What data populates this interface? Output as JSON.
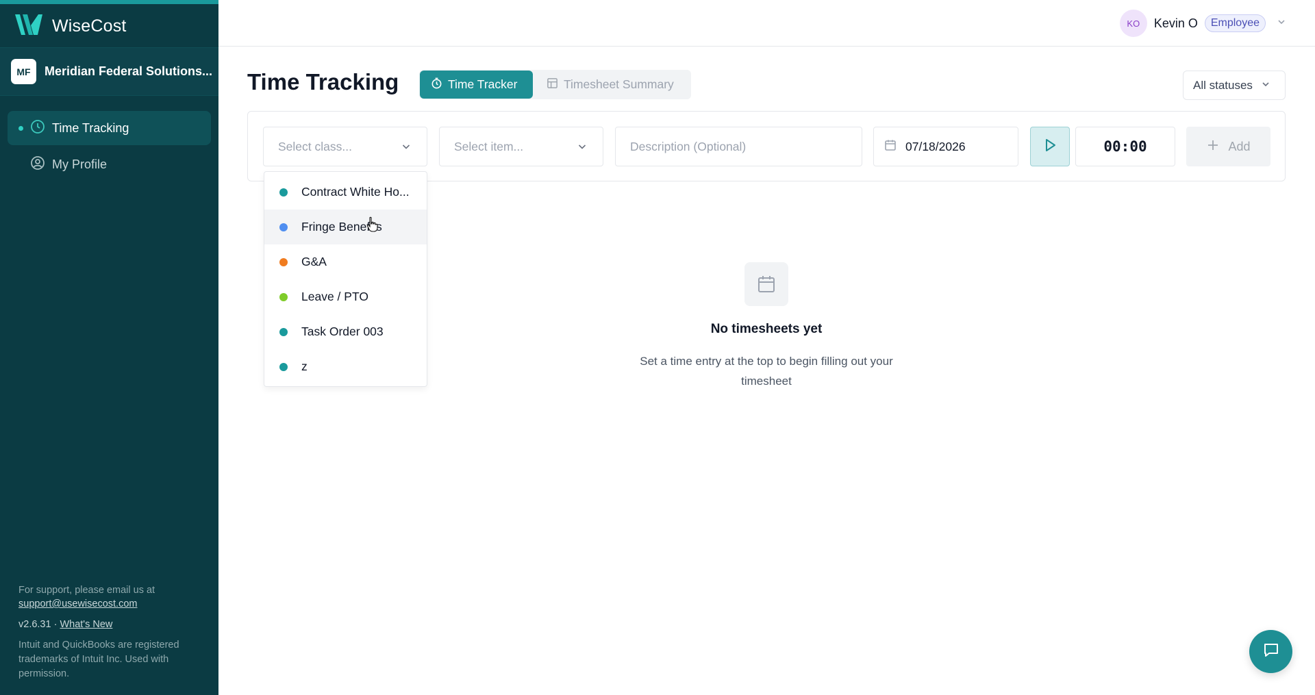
{
  "app": {
    "name": "WiseCost"
  },
  "org": {
    "initials": "MF",
    "name": "Meridian Federal Solutions..."
  },
  "sidebar": {
    "items": [
      {
        "label": "Time Tracking",
        "icon": "clock-icon",
        "active": true
      },
      {
        "label": "My Profile",
        "icon": "user-circle-icon",
        "active": false
      }
    ],
    "support_text": "For support, please email us at",
    "support_email": "support@usewisecost.com",
    "version": "v2.6.31 ·",
    "whats_new": "What's New",
    "legal": "Intuit and QuickBooks are registered trademarks of Intuit Inc. Used with permission."
  },
  "header": {
    "avatar_initials": "KO",
    "user_name": "Kevin O",
    "role": "Employee"
  },
  "page": {
    "title": "Time Tracking",
    "tabs": [
      {
        "label": "Time Tracker",
        "icon": "stopwatch-icon",
        "active": true
      },
      {
        "label": "Timesheet Summary",
        "icon": "table-icon",
        "active": false
      }
    ],
    "status_filter": "All statuses"
  },
  "entry": {
    "class_placeholder": "Select class...",
    "item_placeholder": "Select item...",
    "description_placeholder": "Description (Optional)",
    "date": "07/18/2026",
    "timer": "00:00",
    "add_label": "Add"
  },
  "class_dropdown": {
    "options": [
      {
        "label": "Contract White Ho...",
        "color": "#1a9a9c"
      },
      {
        "label": "Fringe Benefits",
        "color": "#4f8ef0"
      },
      {
        "label": "G&A",
        "color": "#f07c1f"
      },
      {
        "label": "Leave / PTO",
        "color": "#7fcc2a"
      },
      {
        "label": "Task Order 003",
        "color": "#1a9a9c"
      },
      {
        "label": "z",
        "color": "#1a9a9c"
      }
    ],
    "hovered_index": 1
  },
  "empty_state": {
    "title": "No timesheets yet",
    "subtitle": "Set a time entry at the top to begin filling out your timesheet"
  },
  "colors": {
    "sidebar": "#0b3b43",
    "accent": "#1e8f94"
  }
}
